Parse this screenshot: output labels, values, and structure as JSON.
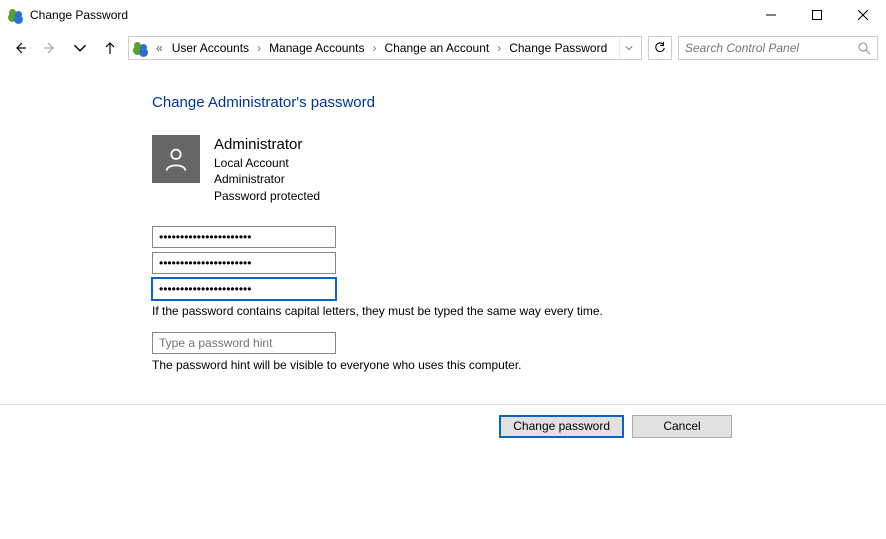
{
  "window": {
    "title": "Change Password"
  },
  "breadcrumb": {
    "overflow": "«",
    "items": [
      "User Accounts",
      "Manage Accounts",
      "Change an Account",
      "Change Password"
    ]
  },
  "search": {
    "placeholder": "Search Control Panel"
  },
  "page": {
    "heading": "Change Administrator's password"
  },
  "account": {
    "name": "Administrator",
    "type": "Local Account",
    "role": "Administrator",
    "status": "Password protected"
  },
  "form": {
    "current_password": "••••••••••••••••••••••",
    "new_password": "••••••••••••••••••••••",
    "confirm_password": "••••••••••••••••••••••",
    "caps_note": "If the password contains capital letters, they must be typed the same way every time.",
    "hint_placeholder": "Type a password hint",
    "hint_note": "The password hint will be visible to everyone who uses this computer."
  },
  "buttons": {
    "primary": "Change password",
    "cancel": "Cancel"
  }
}
